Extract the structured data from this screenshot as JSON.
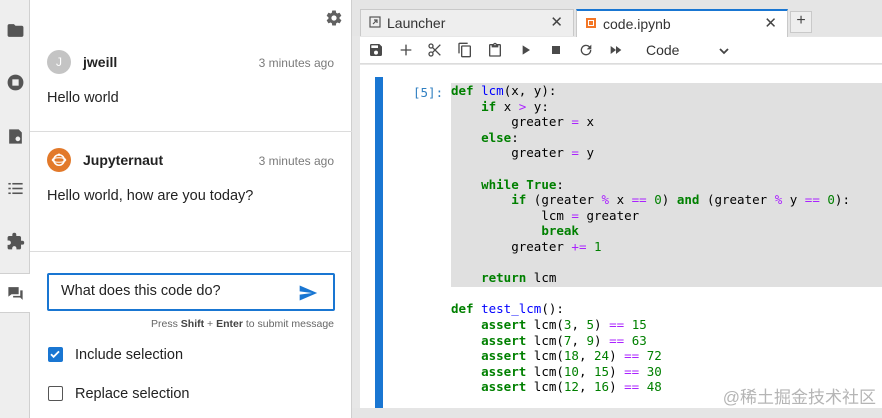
{
  "chat": {
    "messages": [
      {
        "avatar": "J",
        "sender": "jweill",
        "time": "3 minutes ago",
        "body": "Hello world"
      },
      {
        "avatar": "jupyter-logo",
        "sender": "Jupyternaut",
        "time": "3 minutes ago",
        "body": "Hello world, how are you today?"
      }
    ],
    "input_value": "What does this code do?",
    "hint_prefix": "Press",
    "hint_key1": "Shift",
    "hint_plus": "+",
    "hint_key2": "Enter",
    "hint_suffix": "to submit message",
    "include_selection_label": "Include selection",
    "include_selection_checked": true,
    "replace_selection_label": "Replace selection",
    "replace_selection_checked": false
  },
  "tabs": [
    {
      "label": "Launcher",
      "icon": "launcher-icon",
      "active": false
    },
    {
      "label": "code.ipynb",
      "icon": "notebook-icon",
      "active": true
    }
  ],
  "toolbar": {
    "cell_type": "Code"
  },
  "cell": {
    "prompt": "[5]:"
  },
  "watermark": "@稀土掘金技术社区",
  "colors": {
    "accent": "#1976d2",
    "bot_avatar": "#e2792a",
    "code_bg": "#e0e0e0"
  }
}
